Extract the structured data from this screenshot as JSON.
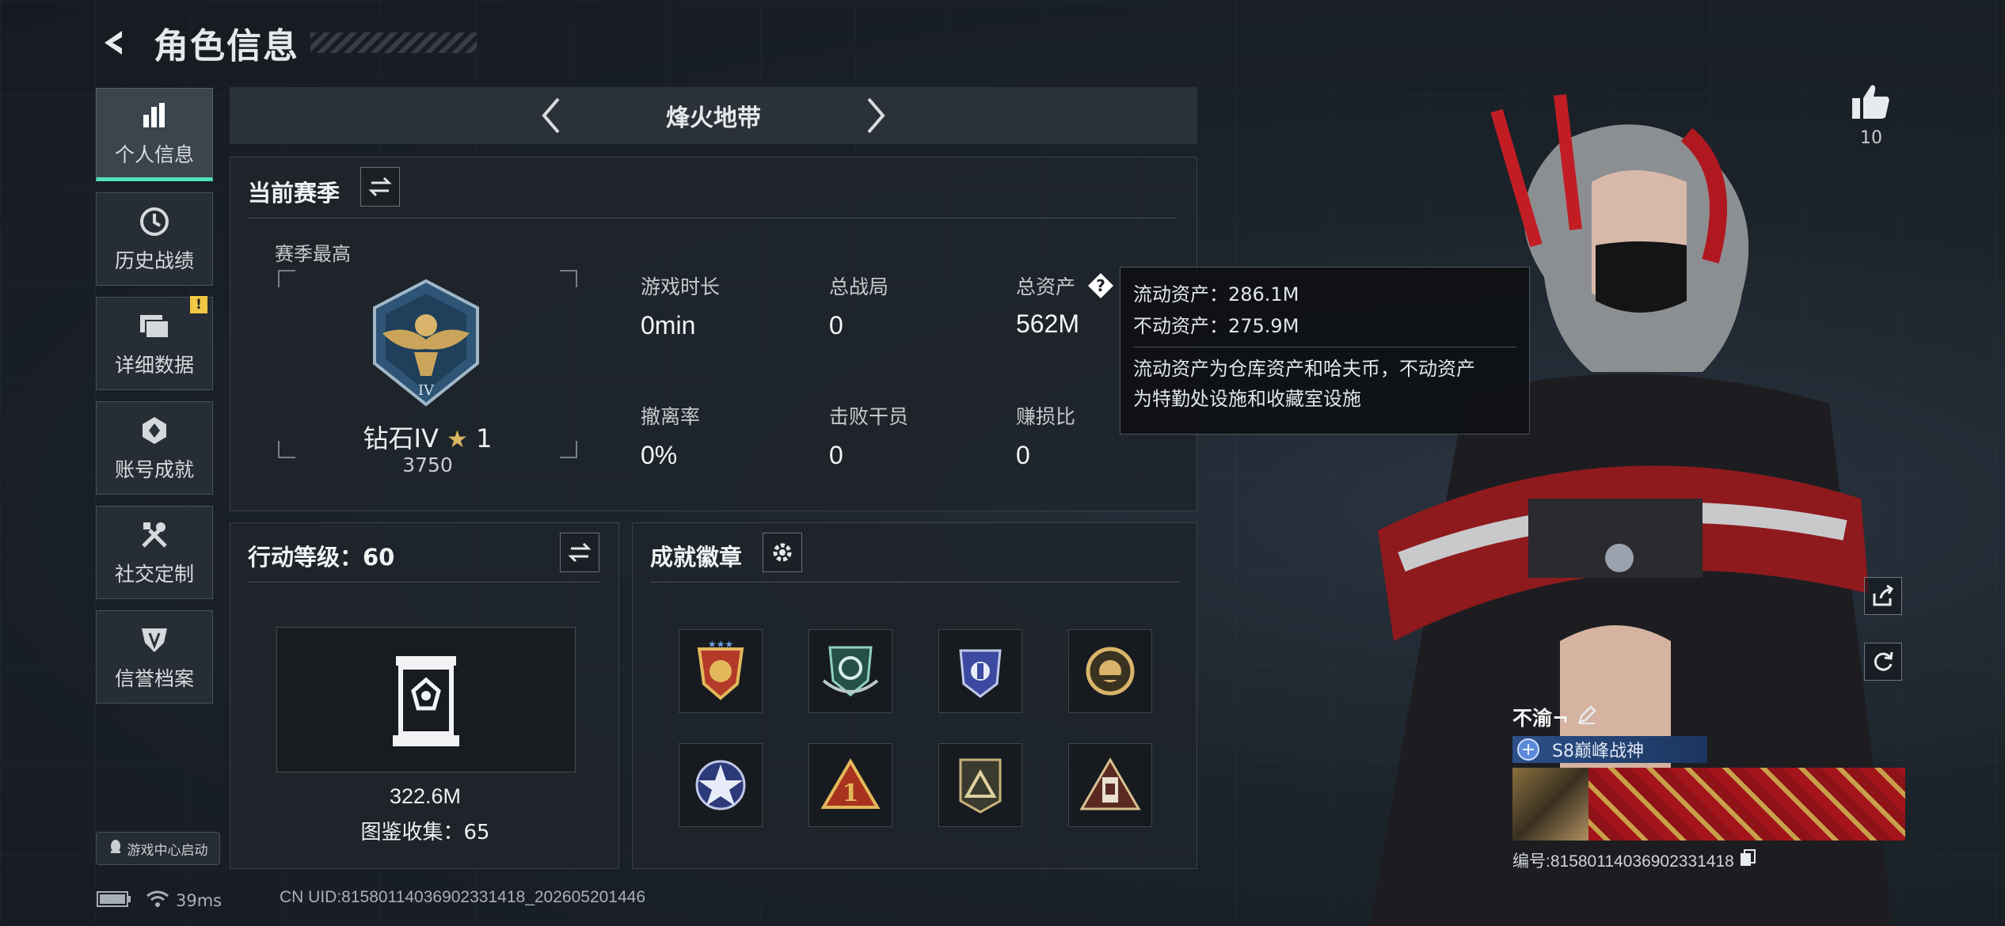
{
  "header": {
    "title": "角色信息"
  },
  "sidebar": {
    "items": [
      {
        "label": "个人信息",
        "icon": "bar-chart-icon",
        "active": true
      },
      {
        "label": "历史战绩",
        "icon": "clock-icon"
      },
      {
        "label": "详细数据",
        "icon": "folders-icon",
        "badge": "!"
      },
      {
        "label": "账号成就",
        "icon": "achievement-icon"
      },
      {
        "label": "社交定制",
        "icon": "tools-icon"
      },
      {
        "label": "信誉档案",
        "icon": "shield-icon"
      }
    ],
    "game_center": "游戏中心启动"
  },
  "mode_bar": {
    "name": "烽火地带"
  },
  "season": {
    "title": "当前赛季",
    "sub_label": "赛季最高",
    "rank_name": "钻石IV",
    "rank_stars": "1",
    "rank_points": "3750",
    "stats": [
      {
        "label": "游戏时长",
        "value": "0min"
      },
      {
        "label": "总战局",
        "value": "0"
      },
      {
        "label": "总资产",
        "value": "562M"
      },
      {
        "label": "撤离率",
        "value": "0%"
      },
      {
        "label": "击败干员",
        "value": "0"
      },
      {
        "label": "赚损比",
        "value": "0"
      }
    ]
  },
  "tooltip": {
    "line1": "流动资产：286.1M",
    "line2": "不动资产：275.9M",
    "desc1": "流动资产为仓库资产和哈夫币，不动资产",
    "desc2": "为特勤处设施和收藏室设施"
  },
  "level": {
    "title": "行动等级：60",
    "value": "322.6M",
    "collection": "图鉴收集：65"
  },
  "achievements": {
    "title": "成就徽章",
    "badges": [
      "star-shield-badge",
      "wings-badge",
      "blue-shield-badge",
      "gold-coin-badge",
      "blue-star-badge",
      "triangle-1-badge",
      "mountain-badge",
      "tower-badge"
    ]
  },
  "footer": {
    "ping": "39ms",
    "uid": "CN UID:815801140369023314​18_202605201446"
  },
  "character": {
    "likes": "10",
    "player_name": "不渝¬",
    "title": "S8巅峰战神",
    "card_id": "编号:815801140369023314​18"
  },
  "colors": {
    "accent": "#4fe0b8",
    "badge_yellow": "#f1c843",
    "title_blue": "#2b4f86"
  }
}
